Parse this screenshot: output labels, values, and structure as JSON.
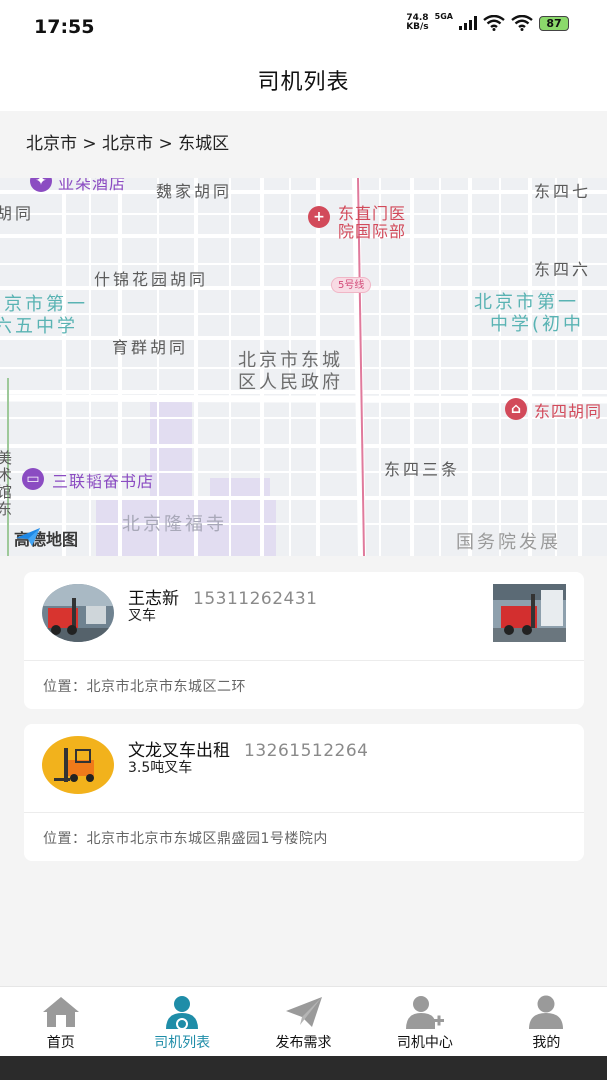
{
  "status": {
    "time": "17:55",
    "net_speed_value": "74.8",
    "net_speed_unit": "KB/s",
    "network": "5GA",
    "battery": "87"
  },
  "header": {
    "title": "司机列表"
  },
  "breadcrumb": "北京市 > 北京市 > 东城区",
  "map": {
    "provider": "高德地图",
    "labels": {
      "hotel": "亚朵酒店",
      "weijia": "魏家胡同",
      "dongzhimen": "东直门医",
      "dongzhimen2": "院国际部",
      "dongsiqi": "东四七",
      "hutong_left": "胡同",
      "dongsiliu": "东四六",
      "shijin": "什锦花园胡同",
      "metro": "5号线",
      "school_left1": "京市第一",
      "school_left2": "六五中学",
      "school_right1": "北京市第一",
      "school_right2": "中学(初中",
      "yuqun": "育群胡同",
      "gov1": "北京市东城",
      "gov2": "区人民政府",
      "dongsihu": "东四胡同",
      "sanlian": "三联韬奋书店",
      "dongsisan": "东四三条",
      "longfu": "北京隆福寺",
      "guowuyuan": "国务院发展",
      "museum": "美术馆东"
    }
  },
  "drivers": [
    {
      "name": "王志新",
      "phone": "15311262431",
      "type": "叉车",
      "location": "位置：北京市北京市东城区二环"
    },
    {
      "name": "文龙叉车出租",
      "phone": "13261512264",
      "type": "3.5吨叉车",
      "location": "位置：北京市北京市东城区鼎盛园1号楼院内"
    }
  ],
  "tabs": [
    {
      "label": "首页",
      "icon": "home-icon",
      "active": false
    },
    {
      "label": "司机列表",
      "icon": "driver-list-icon",
      "active": true
    },
    {
      "label": "发布需求",
      "icon": "paper-plane-icon",
      "active": false
    },
    {
      "label": "司机中心",
      "icon": "driver-center-icon",
      "active": false
    },
    {
      "label": "我的",
      "icon": "profile-icon",
      "active": false
    }
  ],
  "colors": {
    "accent": "#1f8da8",
    "map_bg": "#eef0f3",
    "poi_red": "#d24a5a",
    "poi_purple": "#8b4cc2",
    "metro_line": "#e07a9c"
  }
}
